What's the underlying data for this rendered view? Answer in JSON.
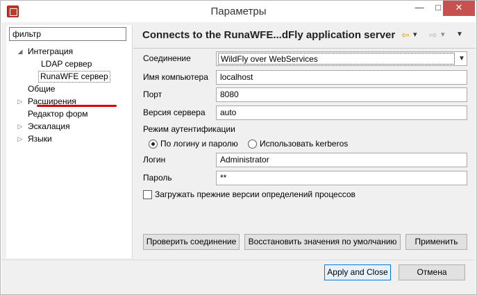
{
  "window": {
    "title": "Параметры",
    "minimize": "—",
    "maximize": "□",
    "close": "✕"
  },
  "filter": {
    "value": "фильтр"
  },
  "tree": {
    "items": [
      {
        "label": "Интеграция",
        "expanded": true,
        "arrow": "◢"
      },
      {
        "label": "LDAP сервер"
      },
      {
        "label": "RunaWFE сервер",
        "selected": true
      },
      {
        "label": "Общие"
      },
      {
        "label": "Расширения",
        "expanded": false,
        "arrow": "▷"
      },
      {
        "label": "Редактор форм"
      },
      {
        "label": "Эскалация",
        "expanded": false,
        "arrow": "▷"
      },
      {
        "label": "Языки",
        "expanded": false,
        "arrow": "▷"
      }
    ]
  },
  "page": {
    "title": "Connects to the RunaWFE...dFly application server",
    "nav": {
      "back": "⇦",
      "back_menu": "▾",
      "forward": "⇨",
      "forward_menu": "▾",
      "view_menu": "▼"
    }
  },
  "form": {
    "connection_label": "Соединение",
    "connection_value": "WildFly over WebServices",
    "host_label": "Имя компьютера",
    "host_value": "localhost",
    "port_label": "Порт",
    "port_value": "8080",
    "server_version_label": "Версия сервера",
    "server_version_value": "auto",
    "auth_mode_label": "Режим аутентификации",
    "auth_login_option": "По логину и паролю",
    "auth_kerberos_option": "Использовать kerberos",
    "login_label": "Логин",
    "login_value": "Administrator",
    "password_label": "Пароль",
    "password_value": "**",
    "load_previous_label": "Загружать прежние версии определений процессов"
  },
  "buttons": {
    "check_connection": "Проверить соединение",
    "restore_defaults": "Восстановить значения по умолчанию",
    "apply": "Применить",
    "apply_close": "Apply and Close",
    "cancel": "Отмена"
  },
  "colors": {
    "close_button": "#c75050",
    "annotation_underline": "#d40000",
    "default_button_border": "#0078d7",
    "nav_back": "#e8a21b"
  }
}
